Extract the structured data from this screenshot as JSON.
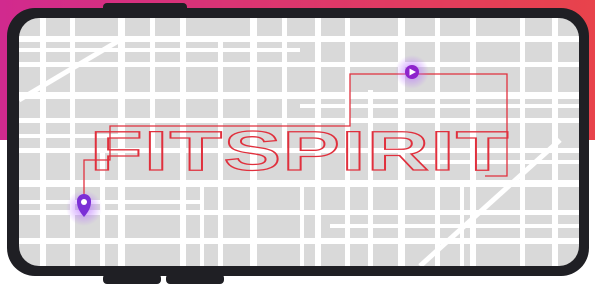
{
  "brand": {
    "logo_text": "FITSPIRIT"
  },
  "colors": {
    "gradient_left": "#d12a8e",
    "gradient_right": "#e8434b",
    "page_background": "#ffffff",
    "phone_frame": "#1f1f24",
    "map_block": "#d9d9d9",
    "map_street": "#ffffff",
    "route_line": "#e0303d",
    "start_pin": "#7b2fd6",
    "end_pin": "#8e24cc",
    "pin_glow": "#b56cff"
  },
  "icons": {
    "start_marker": "map-pin-icon",
    "end_marker": "play-icon"
  }
}
